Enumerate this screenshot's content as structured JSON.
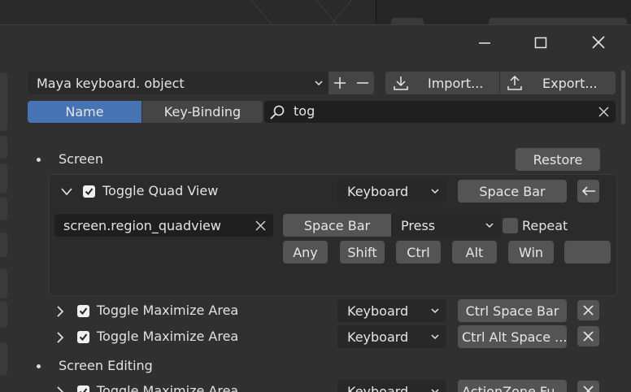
{
  "keymap": {
    "preset_value": "Maya keyboard. object",
    "import_label": "Import...",
    "export_label": "Export..."
  },
  "filter": {
    "mode_name": "Name",
    "mode_key_binding": "Key-Binding",
    "search_value": "tog",
    "active_mode": "Name"
  },
  "sections": {
    "screen": {
      "title": "Screen",
      "restore_label": "Restore"
    },
    "screen_editing": {
      "title": "Screen Editing"
    }
  },
  "items": {
    "quad_view": {
      "name": "Toggle Quad View",
      "input_type": "Keyboard",
      "binding": "Space Bar",
      "operator": "screen.region_quadview",
      "event_key": "Space Bar",
      "event_value": "Press",
      "repeat_label": "Repeat",
      "modifiers": [
        "Any",
        "Shift",
        "Ctrl",
        "Alt",
        "Win"
      ]
    },
    "maximize_1": {
      "name": "Toggle Maximize Area",
      "input_type": "Keyboard",
      "binding": "Ctrl Space Bar"
    },
    "maximize_2": {
      "name": "Toggle Maximize Area",
      "input_type": "Keyboard",
      "binding": "Ctrl Alt Space ..."
    },
    "maximize_3": {
      "name": "Toggle Maximize Area",
      "input_type": "Keyboard",
      "binding": "ActionZone Fu..."
    }
  },
  "colors": {
    "accent": "#4772b3",
    "window_bg": "#303030",
    "panel_bg": "#2b2b2b",
    "button": "#545454",
    "field": "#1f1f1f"
  }
}
